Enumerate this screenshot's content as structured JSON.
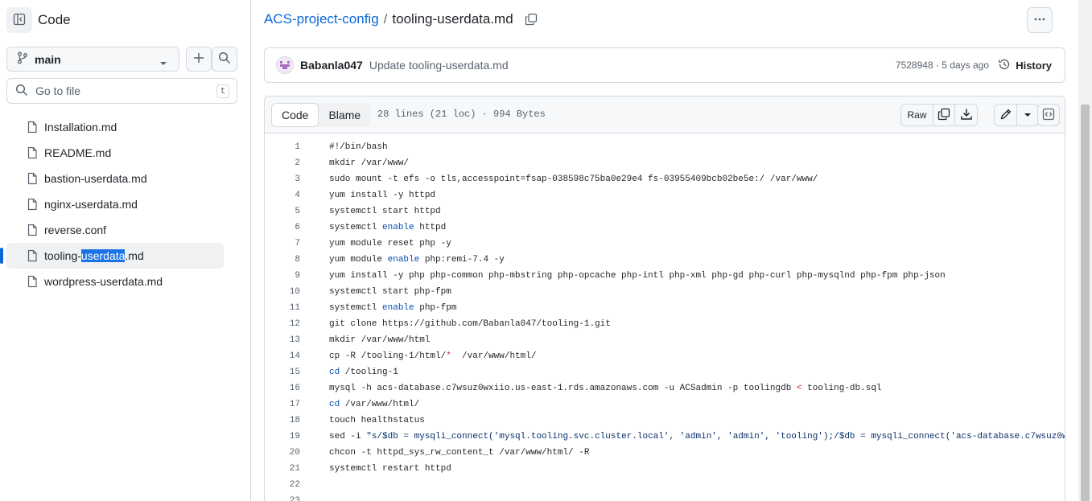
{
  "sidebar": {
    "title": "Code",
    "branch": "main",
    "goto_placeholder": "Go to file",
    "goto_shortcut": "t",
    "files": [
      {
        "label": "Installation.md"
      },
      {
        "label": "README.md"
      },
      {
        "label": "bastion-userdata.md"
      },
      {
        "label": "nginx-userdata.md"
      },
      {
        "label": "reverse.conf"
      },
      {
        "label_before": "tooling-",
        "label_highlight": "userdata",
        "label_after": ".md",
        "active": true
      },
      {
        "label": "wordpress-userdata.md"
      }
    ]
  },
  "breadcrumb": {
    "repo": "ACS-project-config",
    "separator": "/",
    "file": "tooling-userdata.md"
  },
  "commit": {
    "author": "Babanla047",
    "message": "Update tooling-userdata.md",
    "meta": "7528948 · 5 days ago",
    "history_label": "History"
  },
  "file_header": {
    "tab_code": "Code",
    "tab_blame": "Blame",
    "info": "28 lines (21 loc) · 994 Bytes",
    "raw_label": "Raw"
  },
  "code_lines": [
    {
      "n": "1",
      "segs": [
        {
          "t": "#!/bin/bash"
        }
      ]
    },
    {
      "n": "2",
      "segs": [
        {
          "t": "mkdir /var/www/"
        }
      ]
    },
    {
      "n": "3",
      "segs": [
        {
          "t": "sudo mount -t efs -o tls,accesspoint=fsap-038598c75ba0e29e4 fs-03955409bcb02be5e:/ /var/www/"
        }
      ]
    },
    {
      "n": "4",
      "segs": [
        {
          "t": "yum install -y httpd"
        }
      ]
    },
    {
      "n": "5",
      "segs": [
        {
          "t": "systemctl start httpd"
        }
      ]
    },
    {
      "n": "6",
      "segs": [
        {
          "t": "systemctl "
        },
        {
          "t": "enable",
          "c": "kw"
        },
        {
          "t": " httpd"
        }
      ]
    },
    {
      "n": "7",
      "segs": [
        {
          "t": "yum module reset php -y"
        }
      ]
    },
    {
      "n": "8",
      "segs": [
        {
          "t": "yum module "
        },
        {
          "t": "enable",
          "c": "kw"
        },
        {
          "t": " php:remi-7.4 -y"
        }
      ]
    },
    {
      "n": "9",
      "segs": [
        {
          "t": "yum install -y php php-common php-mbstring php-opcache php-intl php-xml php-gd php-curl php-mysqlnd php-fpm php-json"
        }
      ]
    },
    {
      "n": "10",
      "segs": [
        {
          "t": "systemctl start php-fpm"
        }
      ]
    },
    {
      "n": "11",
      "segs": [
        {
          "t": "systemctl "
        },
        {
          "t": "enable",
          "c": "kw"
        },
        {
          "t": " php-fpm"
        }
      ]
    },
    {
      "n": "12",
      "segs": [
        {
          "t": "git clone https://github.com/Babanla047/tooling-1.git"
        }
      ]
    },
    {
      "n": "13",
      "segs": [
        {
          "t": "mkdir /var/www/html"
        }
      ]
    },
    {
      "n": "14",
      "segs": [
        {
          "t": "cp -R /tooling-1/html/"
        },
        {
          "t": "*",
          "c": "op"
        },
        {
          "t": "  /var/www/html/"
        }
      ]
    },
    {
      "n": "15",
      "segs": [
        {
          "t": "cd",
          "c": "kw"
        },
        {
          "t": " /tooling-1"
        }
      ]
    },
    {
      "n": "16",
      "segs": [
        {
          "t": "mysql -h acs-database.c7wsuz0wxiio.us-east-1.rds.amazonaws.com -u ACSadmin -p toolingdb "
        },
        {
          "t": "<",
          "c": "op"
        },
        {
          "t": " tooling-db.sql"
        }
      ]
    },
    {
      "n": "17",
      "segs": [
        {
          "t": "cd",
          "c": "kw"
        },
        {
          "t": " /var/www/html/"
        }
      ]
    },
    {
      "n": "18",
      "segs": [
        {
          "t": "touch healthstatus"
        }
      ]
    },
    {
      "n": "19",
      "segs": [
        {
          "t": "sed -i "
        },
        {
          "t": "\"s/$db = mysqli_connect('mysql.tooling.svc.cluster.local', 'admin', 'admin', 'tooling');/$db = mysqli_connect('acs-database.c7wsuz0w",
          "c": "str"
        }
      ]
    },
    {
      "n": "20",
      "segs": [
        {
          "t": "chcon -t httpd_sys_rw_content_t /var/www/html/ -R"
        }
      ]
    },
    {
      "n": "21",
      "segs": [
        {
          "t": "systemctl restart httpd"
        }
      ]
    },
    {
      "n": "22",
      "segs": [
        {
          "t": ""
        }
      ]
    },
    {
      "n": "23",
      "segs": [
        {
          "t": ""
        }
      ]
    }
  ],
  "colors": {
    "link": "#0969da",
    "active_bar": "#0969da",
    "selection_highlight": "#1a73e8",
    "keyword": "#0550ae",
    "string": "#0a3069",
    "operator": "#cf222e"
  }
}
